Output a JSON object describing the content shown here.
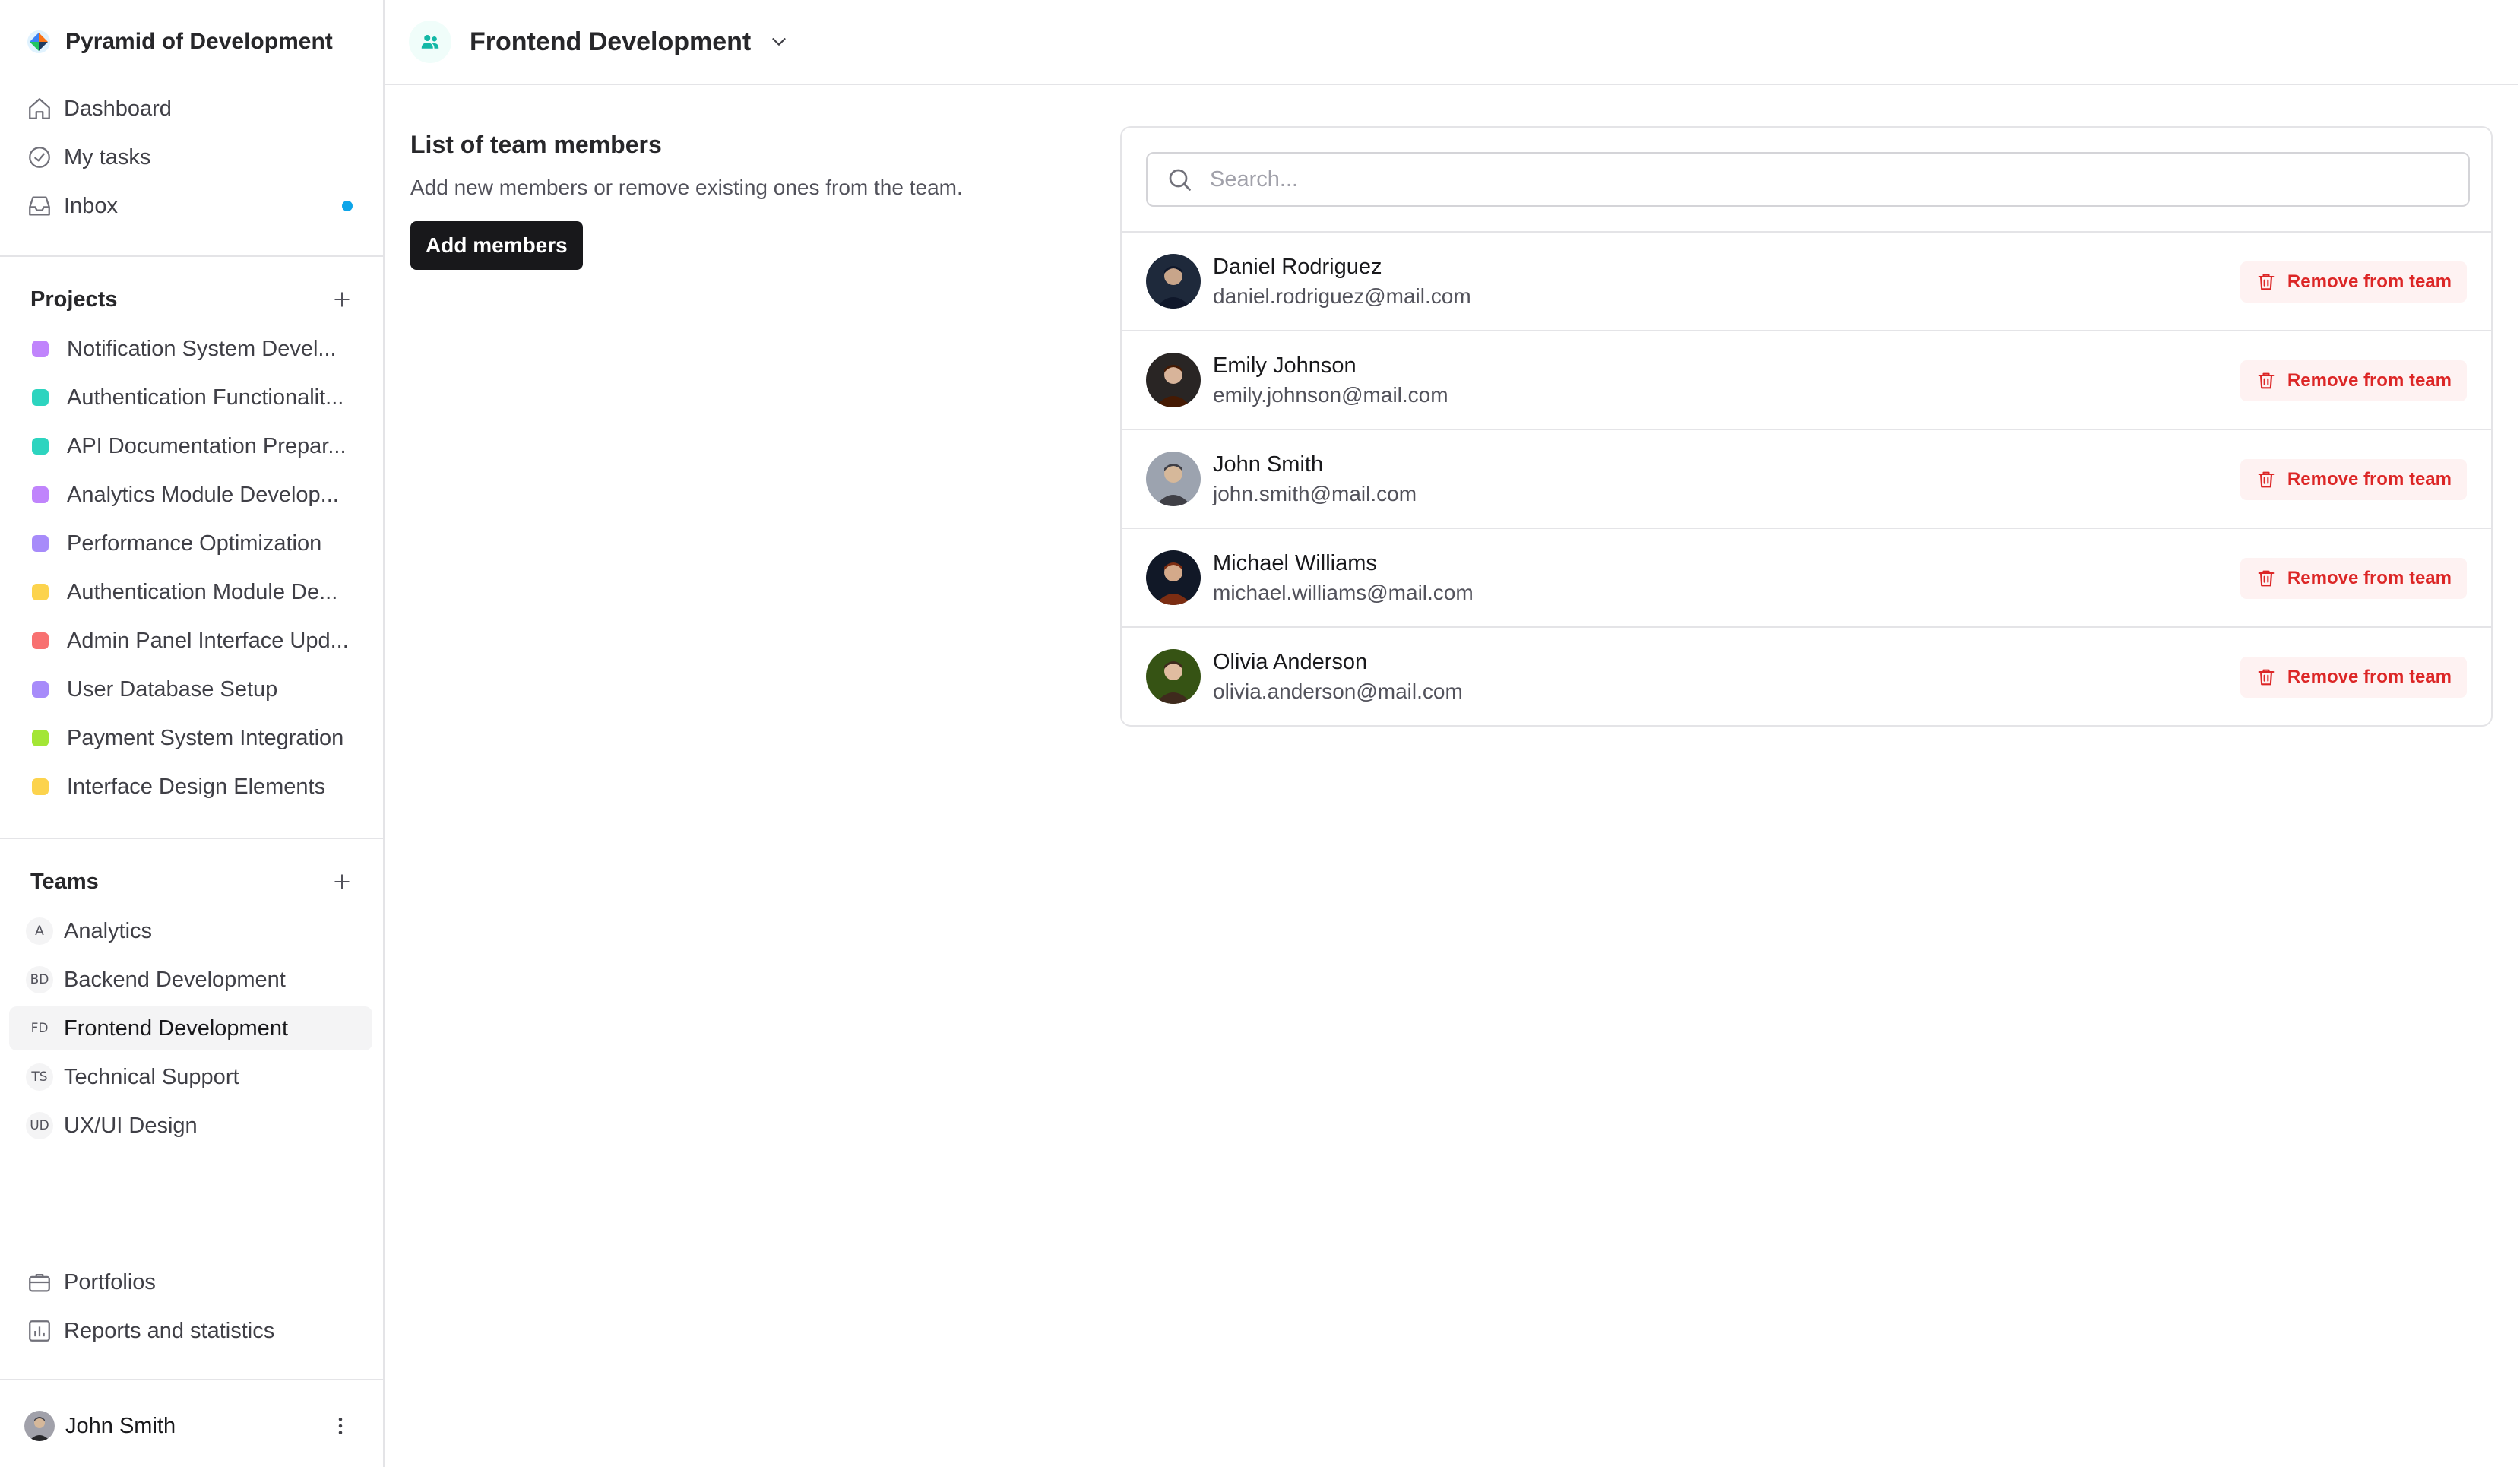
{
  "workspace": {
    "name": "Pyramid of Development",
    "icon": "pyramid-logo-icon"
  },
  "nav": [
    {
      "label": "Dashboard",
      "icon": "home-icon"
    },
    {
      "label": "My tasks",
      "icon": "check-circle-icon"
    },
    {
      "label": "Inbox",
      "icon": "inbox-icon",
      "unread_indicator_color": "#0ea5e9"
    }
  ],
  "projects": {
    "title": "Projects",
    "add_icon": "plus-icon",
    "items": [
      {
        "label": "Notification System Devel...",
        "color": "#c084fc"
      },
      {
        "label": "Authentication Functionalit...",
        "color": "#2dd4bf"
      },
      {
        "label": "API Documentation Prepar...",
        "color": "#2dd4bf"
      },
      {
        "label": "Analytics Module Develop...",
        "color": "#c084fc"
      },
      {
        "label": "Performance Optimization",
        "color": "#a78bfa"
      },
      {
        "label": "Authentication Module De...",
        "color": "#fcd34d"
      },
      {
        "label": "Admin Panel Interface Upd...",
        "color": "#f87171"
      },
      {
        "label": "User Database Setup",
        "color": "#a78bfa"
      },
      {
        "label": "Payment System Integration",
        "color": "#a3e635"
      },
      {
        "label": "Interface Design Elements",
        "color": "#fcd34d"
      }
    ]
  },
  "teams": {
    "title": "Teams",
    "add_icon": "plus-icon",
    "items": [
      {
        "badge": "A",
        "label": "Analytics"
      },
      {
        "badge": "BD",
        "label": "Backend Development"
      },
      {
        "badge": "FD",
        "label": "Frontend Development",
        "active": true
      },
      {
        "badge": "TS",
        "label": "Technical Support"
      },
      {
        "badge": "UD",
        "label": "UX/UI Design"
      }
    ]
  },
  "bottom_nav": [
    {
      "label": "Portfolios",
      "icon": "briefcase-icon"
    },
    {
      "label": "Reports and statistics",
      "icon": "bar-chart-icon"
    }
  ],
  "current_user": {
    "name": "John Smith",
    "menu_icon": "more-vertical-icon"
  },
  "header": {
    "team_name": "Frontend Development",
    "team_icon": "users-icon",
    "dropdown_icon": "chevron-down-icon"
  },
  "intro": {
    "heading": "List of team members",
    "description": "Add new members or remove existing ones from the team.",
    "add_button": "Add members"
  },
  "search": {
    "placeholder": "Search...",
    "value": ""
  },
  "members": [
    {
      "name": "Daniel Rodriguez",
      "email": "daniel.rodriguez@mail.com"
    },
    {
      "name": "Emily Johnson",
      "email": "emily.johnson@mail.com"
    },
    {
      "name": "John Smith",
      "email": "john.smith@mail.com"
    },
    {
      "name": "Michael Williams",
      "email": "michael.williams@mail.com"
    },
    {
      "name": "Olivia Anderson",
      "email": "olivia.anderson@mail.com"
    }
  ],
  "remove_label": "Remove from team",
  "colors": {
    "accent_dark": "#18181b",
    "danger": "#dc2626",
    "danger_bg": "#fef2f2",
    "team_icon": "#14b8a6"
  }
}
